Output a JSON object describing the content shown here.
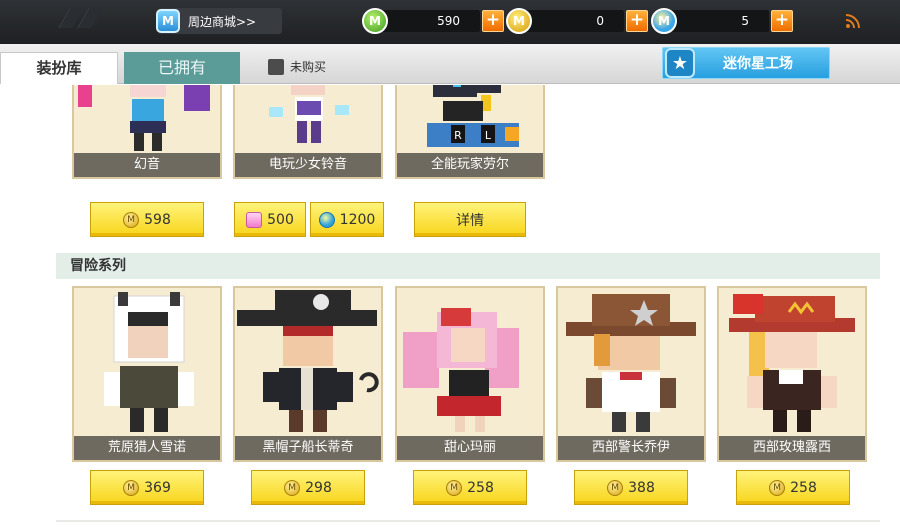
{
  "topbar": {
    "shop_label": "周边商城>>",
    "currencies": [
      {
        "icon": "green-gem-icon",
        "amount": "590",
        "symbol": "M"
      },
      {
        "icon": "gold-coin-icon",
        "amount": "0",
        "symbol": "M"
      },
      {
        "icon": "star-coin-icon",
        "amount": "5",
        "symbol": "M"
      }
    ],
    "plus_label": "+"
  },
  "tabs": {
    "wardrobe": "装扮库",
    "owned": "已拥有",
    "unpurchased": "未购买",
    "workshop": "迷你星工场"
  },
  "top_row": [
    {
      "name": "幻音",
      "prices": [
        {
          "icon": "gold-coin",
          "value": "598"
        }
      ]
    },
    {
      "name": "电玩少女铃音",
      "prices": [
        {
          "icon": "pink-cube",
          "value": "500"
        },
        {
          "icon": "star-coin",
          "value": "1200"
        }
      ]
    },
    {
      "name": "全能玩家劳尔",
      "button": "详情"
    }
  ],
  "section_title": "冒险系列",
  "adventure_row": [
    {
      "name": "荒原猎人雪诺",
      "price": "369"
    },
    {
      "name": "黑帽子船长蒂奇",
      "price": "298"
    },
    {
      "name": "甜心玛丽",
      "price": "258"
    },
    {
      "name": "西部警长乔伊",
      "price": "388"
    },
    {
      "name": "西部玫瑰露西",
      "price": "258"
    }
  ]
}
